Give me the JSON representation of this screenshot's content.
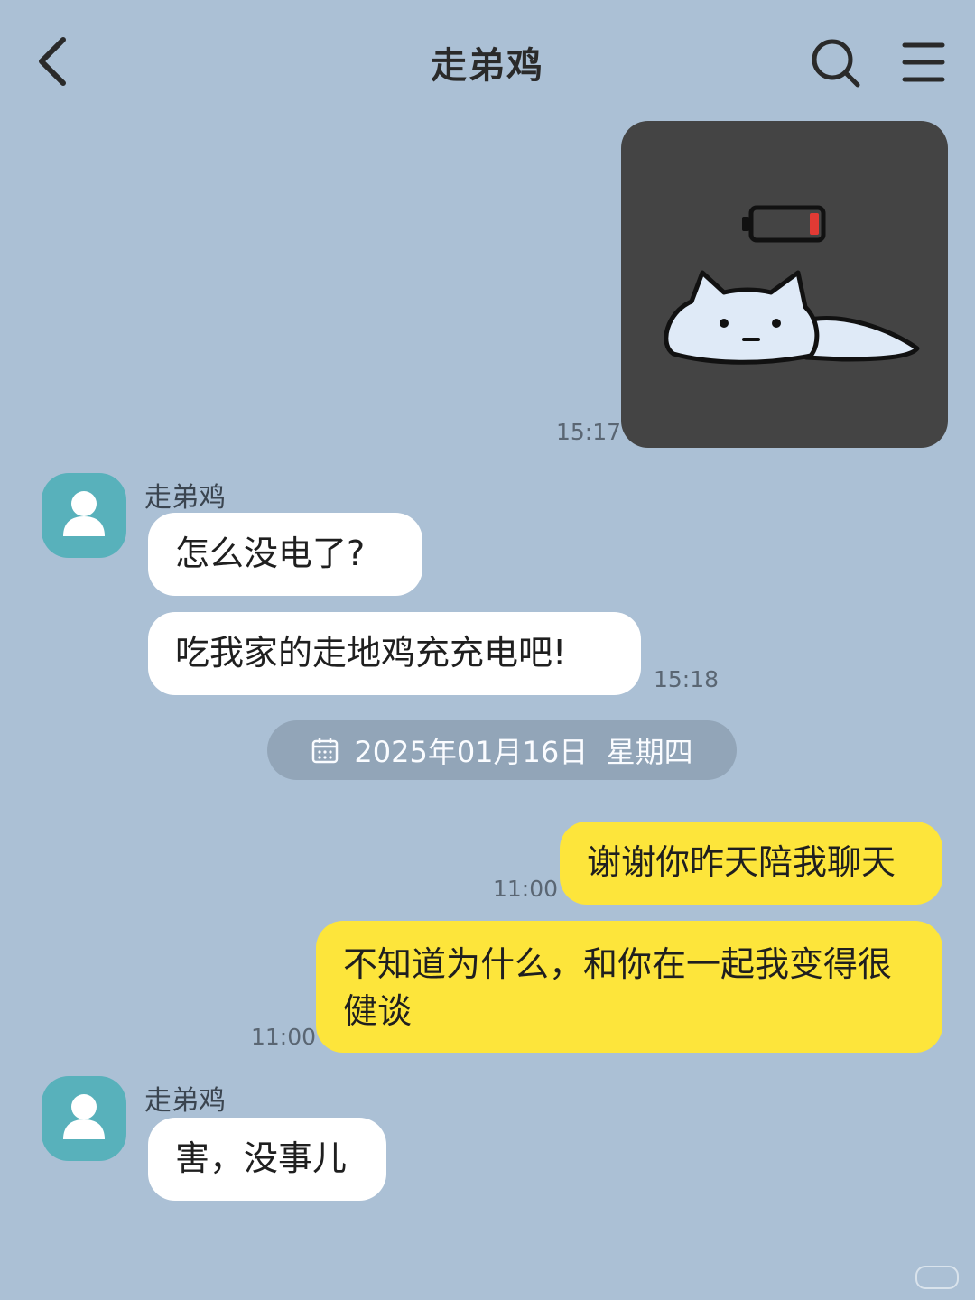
{
  "header": {
    "title": "走弟鸡",
    "back_icon": "chevron-left-icon",
    "search_icon": "search-icon",
    "menu_icon": "menu-icon"
  },
  "messages": {
    "image_time": "15:17",
    "sender_1": "走弟鸡",
    "incoming_1": "怎么没电了?",
    "incoming_2": "吃我家的走地鸡充充电吧!",
    "incoming_2_time": "15:18",
    "date_separator": "2025年01月16日  星期四",
    "outgoing_1": "谢谢你昨天陪我聊天",
    "outgoing_1_time": "11:00",
    "outgoing_2": "不知道为什么，和你在一起我变得很健谈",
    "outgoing_2_time": "11:00",
    "sender_2": "走弟鸡",
    "incoming_3": "害，没事儿"
  },
  "colors": {
    "background": "#abc0d5",
    "incoming_bubble": "#ffffff",
    "outgoing_bubble": "#fde53b",
    "avatar": "#58b1bb",
    "date_pill": "#92a5b8"
  }
}
